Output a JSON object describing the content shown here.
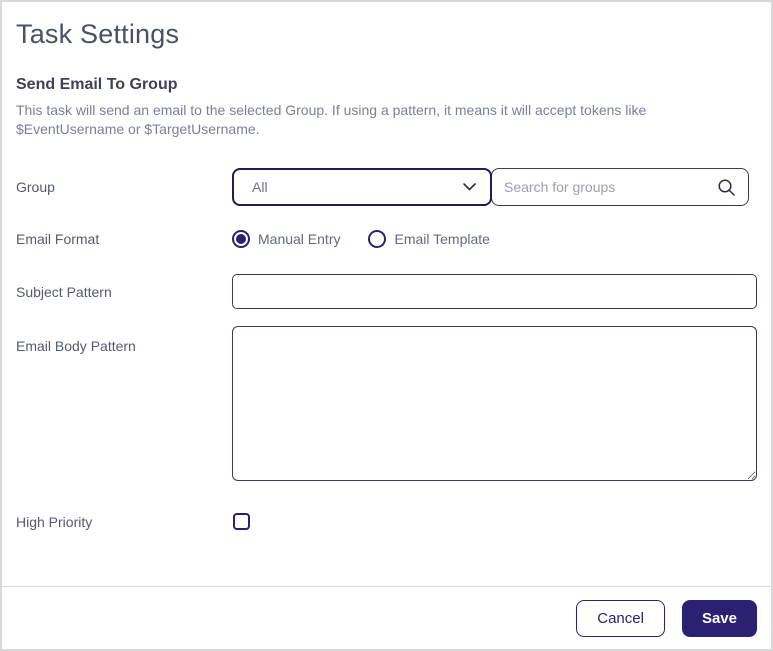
{
  "page": {
    "title": "Task Settings"
  },
  "task": {
    "heading": "Send Email To Group",
    "description": "This task will send an email to the selected Group. If using a pattern, it means it will accept tokens like $EventUsername or $TargetUsername."
  },
  "form": {
    "group": {
      "label": "Group",
      "selected_option": "All",
      "search_placeholder": "Search for groups"
    },
    "email_format": {
      "label": "Email Format",
      "options": [
        {
          "label": "Manual Entry",
          "selected": true
        },
        {
          "label": "Email Template",
          "selected": false
        }
      ]
    },
    "subject_pattern": {
      "label": "Subject Pattern",
      "value": ""
    },
    "email_body_pattern": {
      "label": "Email Body Pattern",
      "value": ""
    },
    "high_priority": {
      "label": "High Priority",
      "checked": false
    }
  },
  "footer": {
    "cancel_label": "Cancel",
    "save_label": "Save"
  },
  "icons": {
    "dropdown": "chevron-down",
    "search": "magnifying-glass"
  },
  "colors": {
    "accent": "#2b2171",
    "select_border": "#221c55",
    "input_border": "#3a3a5c",
    "title_text": "#4a5065",
    "heading_text": "#3f4254",
    "label_text": "#565b6f",
    "desc_text": "#7a8099",
    "placeholder": "#9aa0b5",
    "panel_border": "#d9d9d9",
    "divider": "#d8d8dc"
  }
}
